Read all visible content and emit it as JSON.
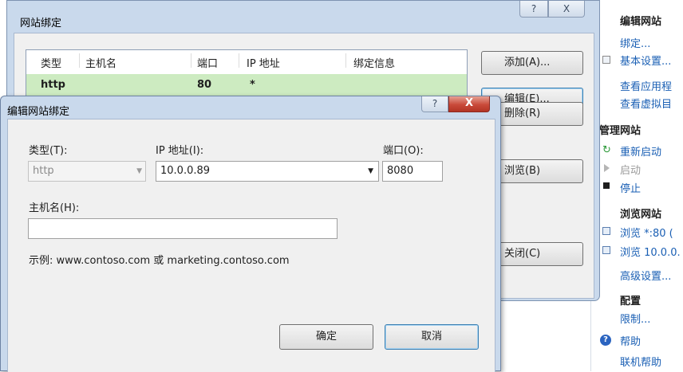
{
  "actions": {
    "edit_site_header": "编辑网站",
    "bindings": "绑定...",
    "basic_settings": "基本设置...",
    "view_apps": "查看应用程",
    "view_vdirs": "查看虚拟目",
    "manage_site_header": "管理网站",
    "restart": "重新启动",
    "start": "启动",
    "stop": "停止",
    "browse_site_header": "浏览网站",
    "browse_80": "浏览 *:80 (",
    "browse_ip": "浏览 10.0.0.",
    "advanced_settings": "高级设置...",
    "config_header": "配置",
    "limits": "限制...",
    "help": "帮助",
    "online_help": "联机帮助"
  },
  "bindings_dialog": {
    "title": "网站绑定",
    "help_glyph": "?",
    "close_glyph": "X",
    "columns": [
      "类型",
      "主机名",
      "端口",
      "IP 地址",
      "绑定信息"
    ],
    "rows": [
      {
        "type": "http",
        "host": "",
        "port": "80",
        "ip": "*",
        "info": ""
      }
    ],
    "buttons": {
      "add": "添加(A)...",
      "edit": "编辑(E)...",
      "remove": "删除(R)",
      "browse": "浏览(B)",
      "close": "关闭(C)"
    }
  },
  "edit_dialog": {
    "title": "编辑网站绑定",
    "help_glyph": "?",
    "close_glyph": "X",
    "type_label": "类型(T):",
    "type_value": "http",
    "ip_label": "IP 地址(I):",
    "ip_value": "10.0.0.89",
    "port_label": "端口(O):",
    "port_value": "8080",
    "host_label": "主机名(H):",
    "host_value": "",
    "example_text": "示例: www.contoso.com 或 marketing.contoso.com",
    "ok": "确定",
    "cancel": "取消"
  }
}
